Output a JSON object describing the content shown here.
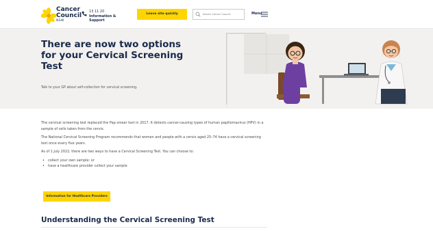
{
  "header": {
    "logo": {
      "line1": "Cancer",
      "line2": "Council",
      "sub": "NSW"
    },
    "phone": {
      "number": "13 11 20",
      "label": "Information & Support",
      "icon": "phone-icon"
    },
    "quick_exit_label": "Leave site quickly",
    "search": {
      "placeholder": "Search Cancer Council",
      "icon": "search-icon"
    },
    "menu": {
      "label": "Menu",
      "icon": "hamburger-icon"
    }
  },
  "hero": {
    "title": "There are now two options for your Cervical Screening Test",
    "subtitle": "Talk to your GP about self-collection for cervical screening."
  },
  "content": {
    "paragraphs": [
      "The cervical screening test replaced the Pap smear test in 2017. It detects cancer-causing types of human papillomavirus (HPV) in a sample of cells taken from the cervix.",
      "The National Cervical Screening Program recommends that women and people with a cervix aged 25–74 have a cervical screening test once every five years.",
      "As of 1 July 2022, there are two ways to have a Cervical Screening Test. You can choose to:"
    ],
    "bullets": [
      "collect your own sample; or",
      "have a healthcare provider collect your sample"
    ],
    "cta_label": "Information for Healthcare Providers",
    "section_heading": "Understanding the Cervical Screening Test"
  },
  "colors": {
    "brand_yellow": "#ffd500",
    "navy": "#1a2a4a",
    "hero_bg": "#f2f1ef"
  }
}
